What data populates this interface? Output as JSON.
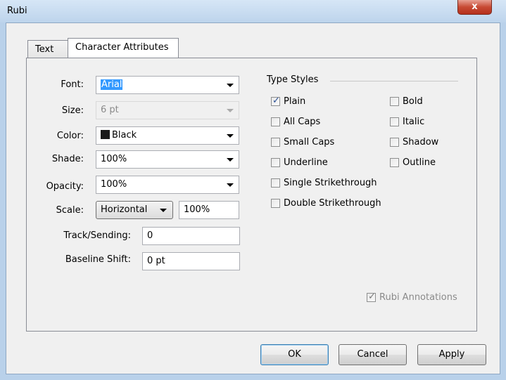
{
  "window": {
    "title": "Rubi",
    "close_glyph": "x"
  },
  "tabs": [
    {
      "label": "Text"
    },
    {
      "label": "Character Attributes"
    }
  ],
  "fields": {
    "font": {
      "label": "Font:",
      "value": "Arial"
    },
    "size": {
      "label": "Size:",
      "value": "6 pt"
    },
    "color": {
      "label": "Color:",
      "value": "Black",
      "swatch": "#1a1a1a"
    },
    "shade": {
      "label": "Shade:",
      "value": "100%"
    },
    "opacity": {
      "label": "Opacity:",
      "value": "100%"
    },
    "scale": {
      "label": "Scale:",
      "direction": "Horizontal",
      "value": "100%"
    },
    "track": {
      "label": "Track/Sending:",
      "value": "0"
    },
    "baseline": {
      "label": "Baseline Shift:",
      "value": "0 pt"
    }
  },
  "type_styles": {
    "title": "Type Styles",
    "items": [
      {
        "label": "Plain",
        "checked": true
      },
      {
        "label": "All Caps",
        "checked": false
      },
      {
        "label": "Small Caps",
        "checked": false
      },
      {
        "label": "Underline",
        "checked": false
      },
      {
        "label": "Single Strikethrough",
        "checked": false
      },
      {
        "label": "Double Strikethrough",
        "checked": false
      },
      {
        "label": "Bold",
        "checked": false
      },
      {
        "label": "Italic",
        "checked": false
      },
      {
        "label": "Shadow",
        "checked": false
      },
      {
        "label": "Outline",
        "checked": false
      }
    ]
  },
  "rubi_annotations": {
    "label": "Rubi Annotations",
    "checked": true,
    "enabled": false
  },
  "buttons": {
    "ok": "OK",
    "cancel": "Cancel",
    "apply": "Apply"
  },
  "colors": {
    "accent": "#3399ff",
    "check": "#2a4f95"
  }
}
